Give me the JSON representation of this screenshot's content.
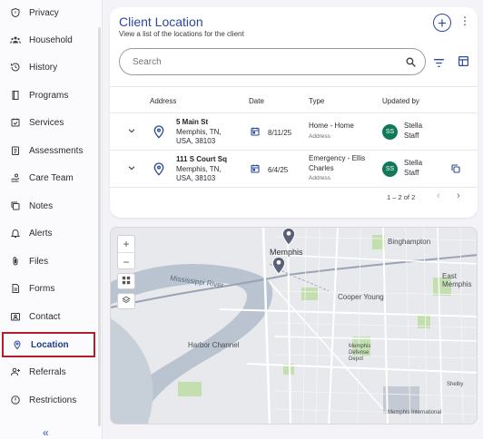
{
  "sidebar": {
    "items": [
      {
        "label": "Privacy",
        "icon": "shield-icon"
      },
      {
        "label": "Household",
        "icon": "people-icon"
      },
      {
        "label": "History",
        "icon": "history-icon"
      },
      {
        "label": "Programs",
        "icon": "book-icon"
      },
      {
        "label": "Services",
        "icon": "calendar-check-icon"
      },
      {
        "label": "Assessments",
        "icon": "clipboard-icon"
      },
      {
        "label": "Care Team",
        "icon": "care-team-icon"
      },
      {
        "label": "Notes",
        "icon": "notes-icon"
      },
      {
        "label": "Alerts",
        "icon": "bell-icon"
      },
      {
        "label": "Files",
        "icon": "paperclip-icon"
      },
      {
        "label": "Forms",
        "icon": "form-icon"
      },
      {
        "label": "Contact",
        "icon": "contact-card-icon"
      },
      {
        "label": "Location",
        "icon": "location-pin-icon",
        "active": true
      },
      {
        "label": "Referrals",
        "icon": "person-add-icon"
      },
      {
        "label": "Restrictions",
        "icon": "restriction-icon"
      }
    ],
    "collapse_label": "«"
  },
  "header": {
    "title": "Client Location",
    "subtitle": "View a list of the locations for the client"
  },
  "search": {
    "placeholder": "Search",
    "value": ""
  },
  "table": {
    "columns": [
      "Address",
      "Date",
      "Type",
      "Updated by"
    ],
    "rows": [
      {
        "street": "5 Main St",
        "city_line": "Memphis, TN,",
        "zip_line": "USA, 38103",
        "date": "8/11/25",
        "type_line1": "Home - Home",
        "type_line2": "",
        "type_sub": "Address",
        "avatar": "SS",
        "updated_first": "Stella",
        "updated_last": "Staff"
      },
      {
        "street": "111 S Court Sq",
        "city_line": "Memphis, TN,",
        "zip_line": "USA, 38103",
        "date": "6/4/25",
        "type_line1": "Emergency - Ellis",
        "type_line2": "Charles",
        "type_sub": "Address",
        "avatar": "SS",
        "updated_first": "Stella",
        "updated_last": "Staff"
      }
    ],
    "pagination": "1 – 2 of 2"
  },
  "map": {
    "zoom_in": "+",
    "zoom_out": "−",
    "labels": {
      "memphis": "Memphis",
      "binghampton": "Binghampton",
      "east_memphis": "East Memphis",
      "mississippi": "Mississippi River",
      "cooper_young": "Cooper Young",
      "harbor_channel": "Harbor Channel",
      "defense_depot": "Memphis Defense Depot",
      "shelby_farms": "Shelby",
      "memphis_intl": "Memphis International"
    }
  },
  "colors": {
    "accent": "#2c4a9a",
    "active_border": "#b41e2a",
    "avatar_bg": "#0e7a5a"
  }
}
